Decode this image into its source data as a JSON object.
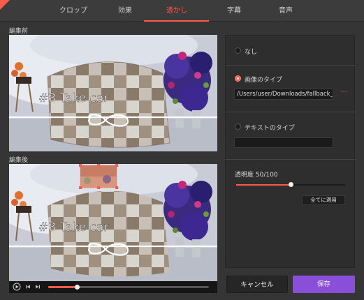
{
  "tabs": [
    {
      "label": "クロップ"
    },
    {
      "label": "効果"
    },
    {
      "label": "透かし"
    },
    {
      "label": "字幕"
    },
    {
      "label": "音声"
    }
  ],
  "active_tab": "透かし",
  "before": {
    "label": "編集前",
    "overlay_text": "#3 Take car"
  },
  "after": {
    "label": "編集後",
    "overlay_text": "#3 Take car"
  },
  "watermark_options": {
    "none_label": "なし",
    "image_label": "画像のタイプ",
    "image_path": "/Users/user/Downloads/fallback_be",
    "more_label": "···",
    "text_label": "テキストのタイプ",
    "text_value": "",
    "selected": "image"
  },
  "transparency": {
    "label": "透明度 50/100",
    "value_percent": 50
  },
  "apply_all_label": "全てに適用",
  "cancel_label": "キャンセル",
  "save_label": "保存",
  "player": {
    "progress_fraction": 0.18
  },
  "colors": {
    "accent": "#ff5a4a",
    "save_button": "#8a4fd8",
    "background": "#353535"
  },
  "icons": [
    "play-icon",
    "step-back-icon",
    "step-forward-icon",
    "close-icon"
  ]
}
